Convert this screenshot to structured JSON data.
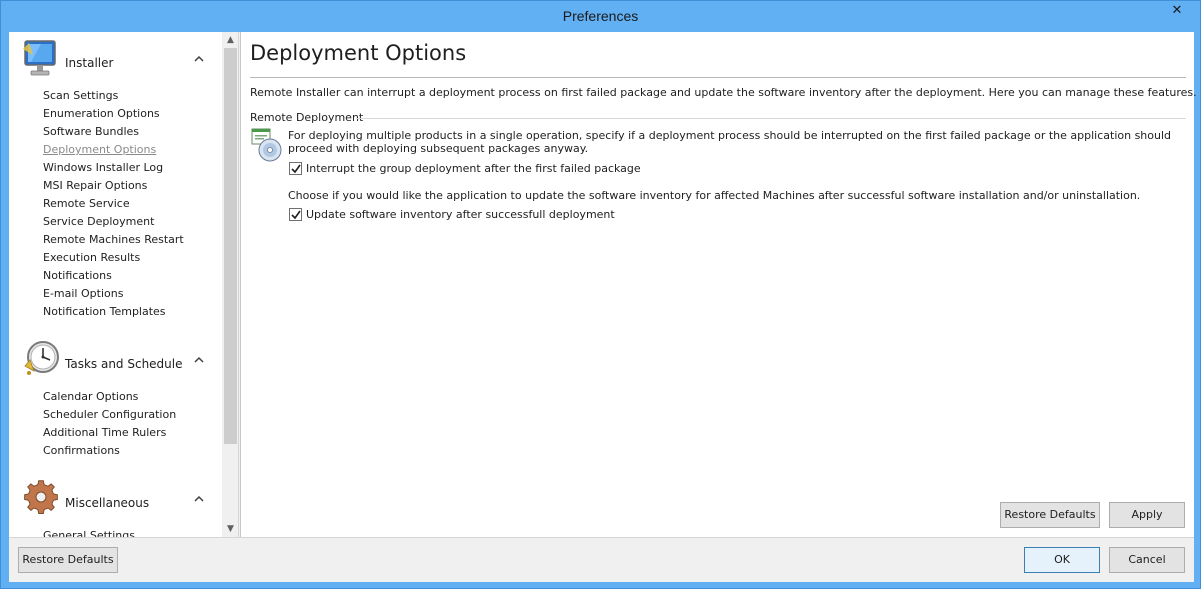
{
  "window": {
    "title": "Preferences",
    "close_glyph": "✕"
  },
  "nav": {
    "groups": [
      {
        "title": "Installer",
        "icon": "monitor-icon",
        "items": [
          "Scan Settings",
          "Enumeration Options",
          "Software Bundles",
          "Deployment Options",
          "Windows Installer Log",
          "MSI Repair Options",
          "Remote Service",
          "Service Deployment",
          "Remote Machines Restart",
          "Execution Results",
          "Notifications",
          "E-mail Options",
          "Notification Templates"
        ],
        "active_item": "Deployment Options"
      },
      {
        "title": "Tasks and Schedule",
        "icon": "clock-icon",
        "items": [
          "Calendar Options",
          "Scheduler Configuration",
          "Additional Time Rulers",
          "Confirmations"
        ]
      },
      {
        "title": "Miscellaneous",
        "icon": "gear-icon",
        "items": [
          "General Settings"
        ]
      }
    ]
  },
  "main": {
    "title": "Deployment Options",
    "intro": "Remote Installer can interrupt a deployment process on first failed package and update the software inventory after the deployment. Here you can manage these features.",
    "section_label": "Remote Deployment",
    "section_icon": "software-deploy-icon",
    "desc1": "For deploying multiple products in a single operation, specify if a deployment process should be interrupted on the first failed package or the application should proceed with deploying subsequent packages anyway.",
    "check1": {
      "label": "Interrupt the group deployment after the first failed package",
      "checked": true
    },
    "desc2": "Choose if you would like the application to update the software inventory for affected Machines after successful software installation and/or uninstallation.",
    "check2": {
      "label": "Update software inventory after successfull deployment",
      "checked": true
    },
    "restore_defaults": "Restore Defaults",
    "apply": "Apply"
  },
  "footer": {
    "restore_defaults": "Restore Defaults",
    "ok": "OK",
    "cancel": "Cancel"
  },
  "colors": {
    "titlebar": "#62b0f4",
    "accent": "#3c7fb1"
  }
}
